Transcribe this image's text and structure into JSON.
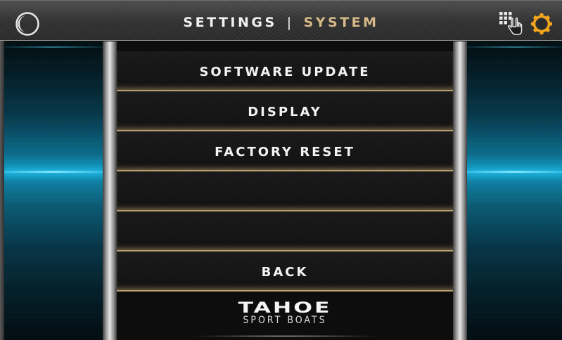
{
  "header": {
    "title_primary": "SETTINGS",
    "separator": "|",
    "title_secondary": "SYSTEM",
    "left_icon": "moon-icon",
    "right_icons": [
      "touch-grid-icon",
      "gear-icon"
    ]
  },
  "menu": {
    "items": [
      {
        "label": "SOFTWARE UPDATE"
      },
      {
        "label": "DISPLAY"
      },
      {
        "label": "FACTORY RESET"
      },
      {
        "label": ""
      },
      {
        "label": ""
      },
      {
        "label": "BACK"
      }
    ]
  },
  "logo": {
    "brand": "TAHOE",
    "tagline": "SPORT BOATS"
  },
  "colors": {
    "title_primary": "#f1f1f1",
    "title_secondary": "#d6ba88",
    "gear_icon": "#f3a51c",
    "accent_blue": "#13a7d2",
    "menu_divider": "#b79e6f"
  }
}
